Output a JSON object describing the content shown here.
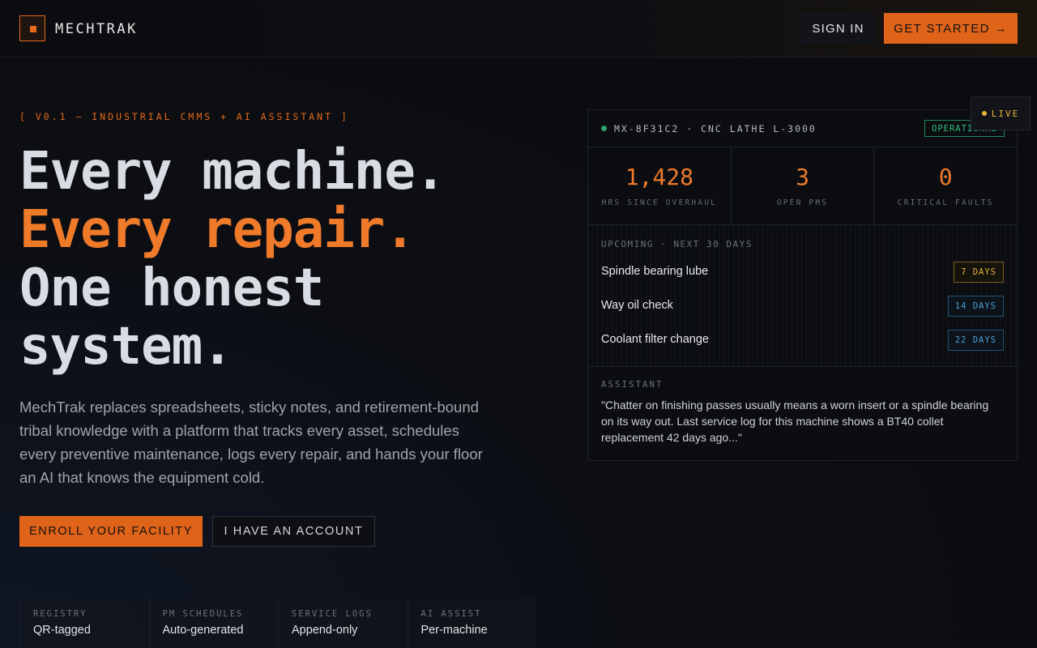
{
  "header": {
    "brand": "MECHTRAK",
    "sign_in": "SIGN IN",
    "get_started": "GET STARTED →"
  },
  "hero": {
    "kicker": "[ V0.1 — INDUSTRIAL CMMS + AI ASSISTANT ]",
    "headline": [
      "Every machine.",
      "Every repair.",
      "One honest",
      "system."
    ],
    "lede": "MechTrak replaces spreadsheets, sticky notes, and retirement-bound tribal knowledge with a platform that tracks every asset, schedules every preventive maintenance, logs every repair, and hands your floor an AI that knows the equipment cold.",
    "enroll": "ENROLL YOUR FACILITY",
    "account": "I HAVE AN ACCOUNT"
  },
  "features": [
    {
      "key": "REGISTRY",
      "value": "QR-tagged"
    },
    {
      "key": "PM SCHEDULES",
      "value": "Auto-generated"
    },
    {
      "key": "SERVICE LOGS",
      "value": "Append-only"
    },
    {
      "key": "AI ASSIST",
      "value": "Per-machine"
    }
  ],
  "panel": {
    "live": "LIVE",
    "machine": "MX-8F31C2 · CNC LATHE L-3000",
    "status": "OPERATIONAL",
    "stats": [
      {
        "num": "1,428",
        "label": "HRS SINCE OVERHAUL"
      },
      {
        "num": "3",
        "label": "OPEN PMS"
      },
      {
        "num": "0",
        "label": "CRITICAL FAULTS"
      }
    ],
    "upcoming_title": "UPCOMING · NEXT 30 DAYS",
    "tasks": [
      {
        "name": "Spindle bearing lube",
        "due": "7 DAYS"
      },
      {
        "name": "Way oil check",
        "due": "14 DAYS"
      },
      {
        "name": "Coolant filter change",
        "due": "22 DAYS"
      }
    ],
    "assistant_label": "ASSISTANT",
    "assistant_quote": "\"Chatter on finishing passes usually means a worn insert or a spindle bearing on its way out. Last service log for this machine shows a BT40 collet replacement 42 days ago...\""
  },
  "colors": {
    "accent": "#e0631a",
    "operational": "#2fbf7c",
    "amber": "#e3b43b",
    "blue": "#4aa0d8"
  }
}
